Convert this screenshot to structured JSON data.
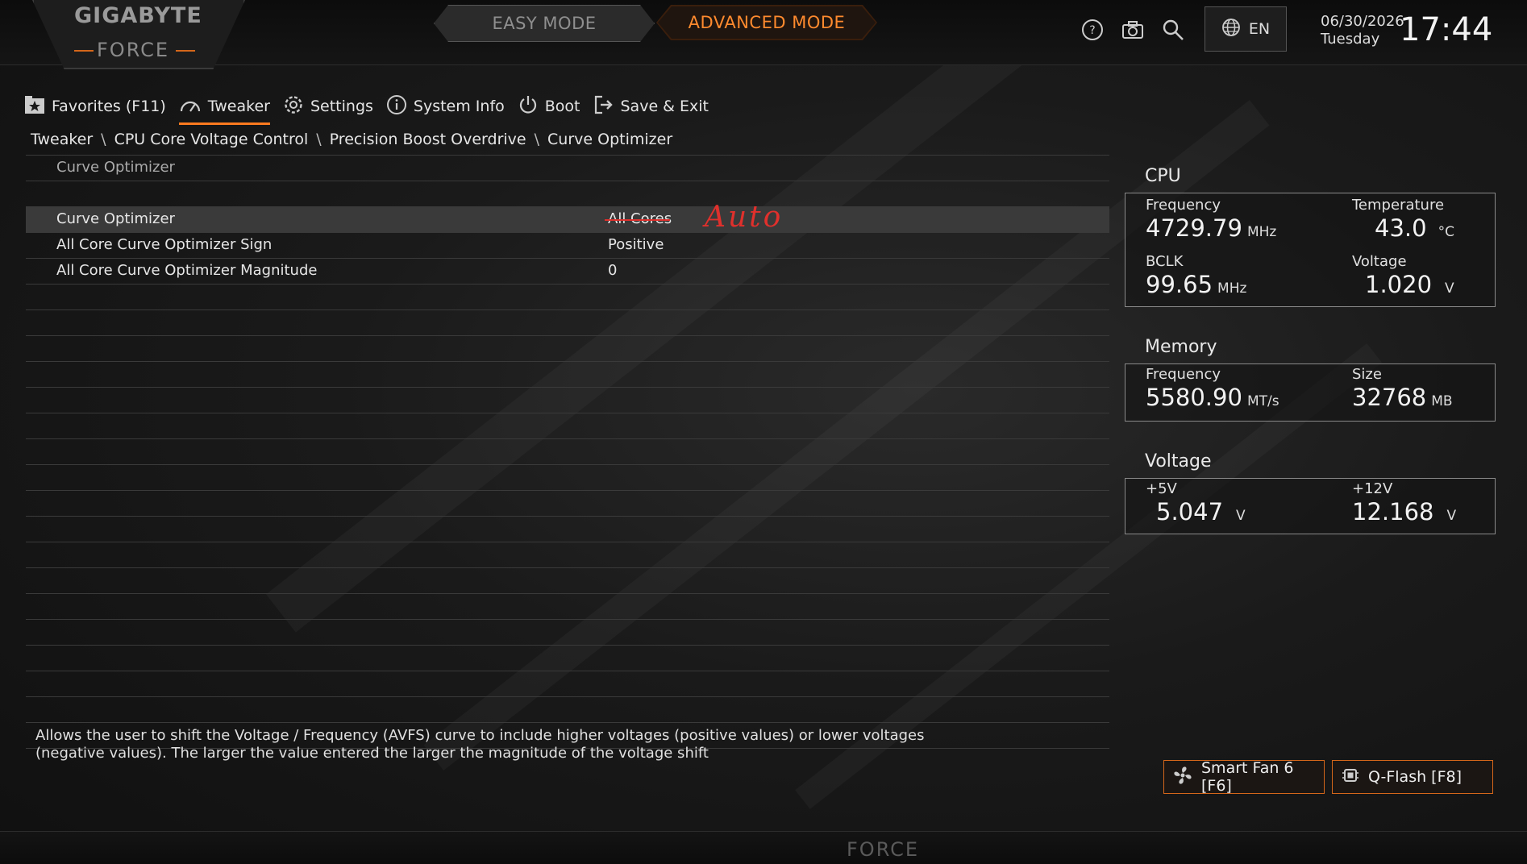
{
  "brand": {
    "name": "GIGABYTE",
    "sub": "FORCE"
  },
  "modes": {
    "easy": "EASY MODE",
    "advanced": "ADVANCED MODE"
  },
  "header": {
    "lang": "EN",
    "date": "06/30/2026",
    "day": "Tuesday",
    "time": "17:44"
  },
  "nav": {
    "favorites": "Favorites (F11)",
    "tweaker": "Tweaker",
    "settings": "Settings",
    "system_info": "System Info",
    "boot": "Boot",
    "save_exit": "Save & Exit"
  },
  "breadcrumb": [
    "Tweaker",
    "CPU Core Voltage Control",
    "Precision Boost Overdrive",
    "Curve Optimizer"
  ],
  "breadcrumb_sep": "\\",
  "section_title": "Curve Optimizer",
  "settings": [
    {
      "label": "Curve Optimizer",
      "value": "All Cores",
      "annotation": "Auto"
    },
    {
      "label": "All Core Curve Optimizer Sign",
      "value": "Positive"
    },
    {
      "label": "All Core Curve Optimizer Magnitude",
      "value": "0"
    }
  ],
  "help_text": "Allows the user to shift the Voltage / Frequency (AVFS) curve to include higher voltages (positive values) or lower voltages (negative values). The larger the value entered the larger the magnitude of the voltage shift",
  "cpu": {
    "title": "CPU",
    "frequency_label": "Frequency",
    "frequency": "4729.79",
    "frequency_unit": "MHz",
    "temperature_label": "Temperature",
    "temperature": "43.0",
    "temperature_unit": "°C",
    "bclk_label": "BCLK",
    "bclk": "99.65",
    "bclk_unit": "MHz",
    "voltage_label": "Voltage",
    "voltage": "1.020",
    "voltage_unit": "V"
  },
  "memory": {
    "title": "Memory",
    "frequency_label": "Frequency",
    "frequency": "5580.90",
    "frequency_unit": "MT/s",
    "size_label": "Size",
    "size": "32768",
    "size_unit": "MB"
  },
  "voltage": {
    "title": "Voltage",
    "v5_label": "+5V",
    "v5": "5.047",
    "v5_unit": "V",
    "v12_label": "+12V",
    "v12": "12.168",
    "v12_unit": "V"
  },
  "buttons": {
    "smart_fan": "Smart Fan 6 [F6]",
    "qflash": "Q-Flash [F8]"
  },
  "footer_brand": "FORCE",
  "colors": {
    "accent": "#ff7a1f",
    "annotation": "#e0302c"
  }
}
